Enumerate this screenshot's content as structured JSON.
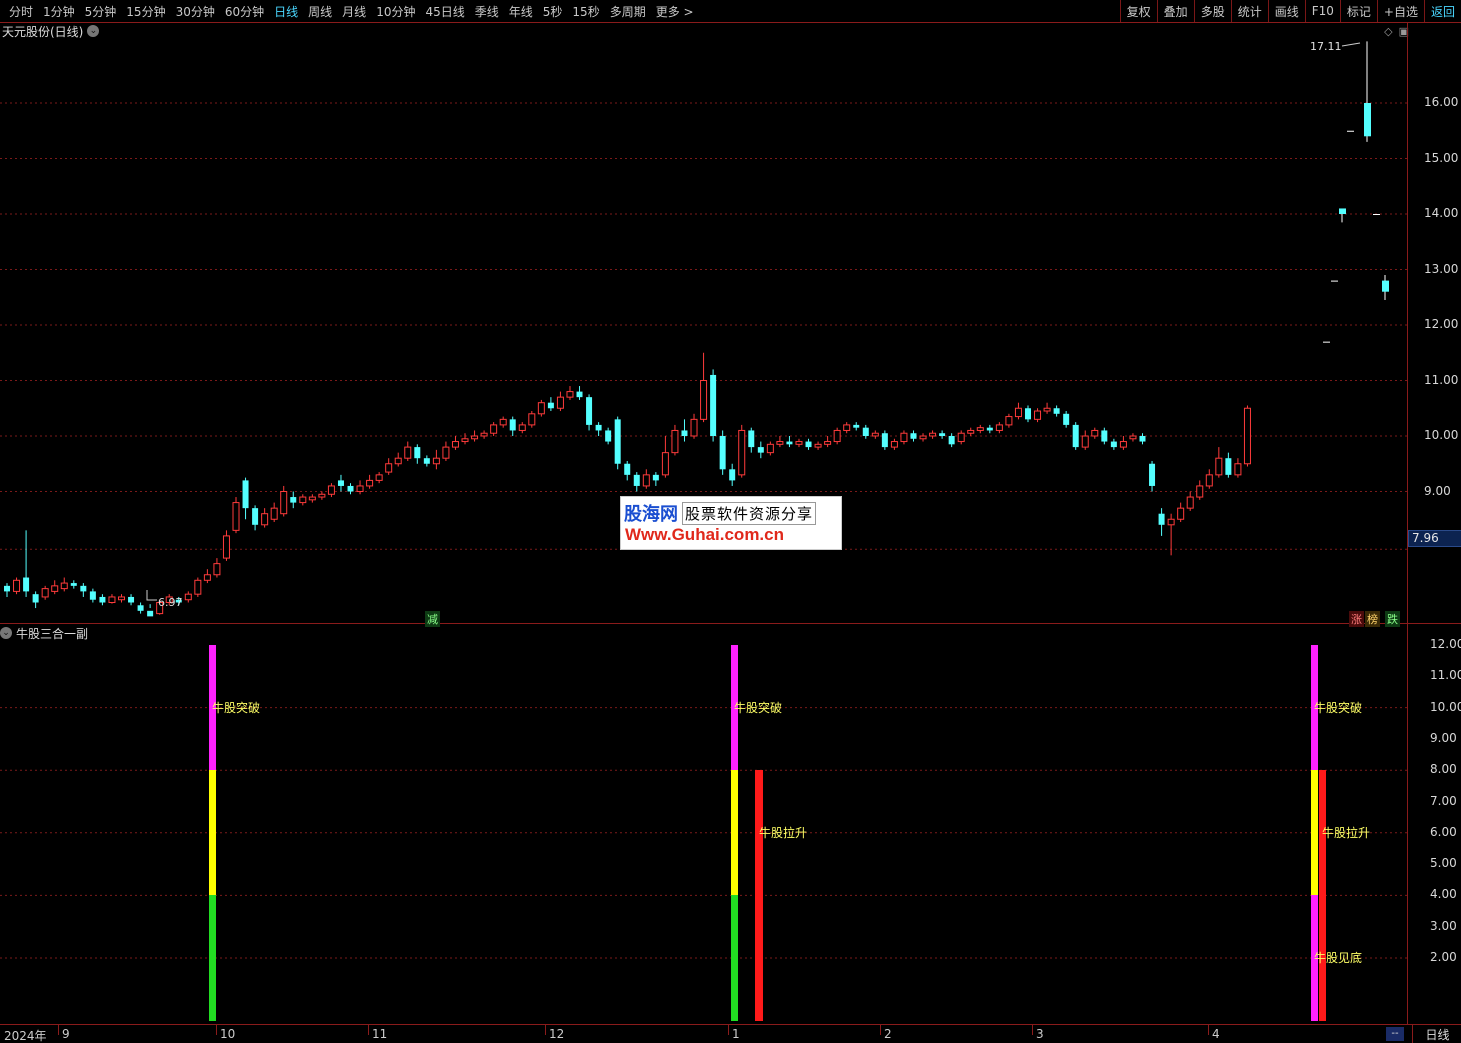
{
  "toolbar": {
    "periods": [
      "分时",
      "1分钟",
      "5分钟",
      "15分钟",
      "30分钟",
      "60分钟",
      "日线",
      "周线",
      "月线",
      "10分钟",
      "45日线",
      "季线",
      "年线",
      "5秒",
      "15秒",
      "多周期",
      "更多 >"
    ],
    "active_period": "日线",
    "tools": [
      "复权",
      "叠加",
      "多股",
      "统计",
      "画线",
      "F10",
      "标记",
      "+自选",
      "返回"
    ]
  },
  "main_panel": {
    "title": "天元股份(日线)",
    "high_label": "17.11",
    "low_label": "6.97",
    "current_price_tag": "7.96",
    "price_axis": [
      "16.00",
      "15.00",
      "14.00",
      "13.00",
      "12.00",
      "11.00",
      "10.00",
      "9.00"
    ],
    "badges": {
      "reduce": "减",
      "up": "涨",
      "rank": "榜",
      "down": "跌"
    }
  },
  "sub_panel": {
    "title": "牛股三合一副",
    "axis": [
      "12.00",
      "11.00",
      "10.00",
      "9.00",
      "8.00",
      "7.00",
      "6.00",
      "5.00",
      "4.00",
      "3.00",
      "2.00"
    ],
    "signals": {
      "breakout": "牛股突破",
      "lift": "牛股拉升",
      "bottom": "牛股见底"
    }
  },
  "time_axis": {
    "labels": [
      "2024年",
      "9",
      "10",
      "11",
      "12",
      "1",
      "2",
      "3",
      "4"
    ],
    "period_button": "日线",
    "dash_button": "--"
  },
  "watermark": {
    "brand": "股海网",
    "slogan": "股票软件资源分享",
    "url": "Www.Guhai.com.cn"
  },
  "chart_data": {
    "type": "candlestick",
    "title": "天元股份(日线)",
    "ylim": [
      7.5,
      17.5
    ],
    "highest": 17.11,
    "lowest": 6.97,
    "last_price": 7.96,
    "up_color": "#ff3b3b",
    "down_color": "#54ffff",
    "candles": [
      [
        7.3,
        7.2,
        7.1,
        7.35
      ],
      [
        7.2,
        7.4,
        7.15,
        7.45
      ],
      [
        7.45,
        7.2,
        7.1,
        8.3
      ],
      [
        7.15,
        7.0,
        6.9,
        7.2
      ],
      [
        7.1,
        7.25,
        7.05,
        7.3
      ],
      [
        7.2,
        7.3,
        7.15,
        7.4
      ],
      [
        7.25,
        7.35,
        7.2,
        7.45
      ],
      [
        7.35,
        7.3,
        7.25,
        7.4
      ],
      [
        7.3,
        7.2,
        7.1,
        7.35
      ],
      [
        7.2,
        7.05,
        7.0,
        7.25
      ],
      [
        7.1,
        7.0,
        6.95,
        7.15
      ],
      [
        7.0,
        7.1,
        6.98,
        7.15
      ],
      [
        7.05,
        7.1,
        7.0,
        7.15
      ],
      [
        7.1,
        7.0,
        6.95,
        7.15
      ],
      [
        6.95,
        6.85,
        6.8,
        7.0
      ],
      [
        6.85,
        6.75,
        6.97,
        6.9
      ],
      [
        6.8,
        7.0,
        6.78,
        7.05
      ],
      [
        7.0,
        7.1,
        6.95,
        7.15
      ],
      [
        7.05,
        7.0,
        6.95,
        7.1
      ],
      [
        7.05,
        7.15,
        7.0,
        7.2
      ],
      [
        7.15,
        7.4,
        7.1,
        7.45
      ],
      [
        7.4,
        7.5,
        7.35,
        7.6
      ],
      [
        7.5,
        7.7,
        7.45,
        7.8
      ],
      [
        7.8,
        8.2,
        7.75,
        8.3
      ],
      [
        8.3,
        8.8,
        8.25,
        8.9
      ],
      [
        9.2,
        8.7,
        8.5,
        9.25
      ],
      [
        8.7,
        8.4,
        8.3,
        8.75
      ],
      [
        8.4,
        8.6,
        8.35,
        8.7
      ],
      [
        8.5,
        8.7,
        8.45,
        8.8
      ],
      [
        8.6,
        9.0,
        8.55,
        9.1
      ],
      [
        8.9,
        8.8,
        8.7,
        9.0
      ],
      [
        8.8,
        8.9,
        8.75,
        8.95
      ],
      [
        8.85,
        8.9,
        8.8,
        8.95
      ],
      [
        8.9,
        8.95,
        8.85,
        9.0
      ],
      [
        8.95,
        9.1,
        8.9,
        9.15
      ],
      [
        9.2,
        9.1,
        9.0,
        9.3
      ],
      [
        9.1,
        9.0,
        8.95,
        9.15
      ],
      [
        9.0,
        9.1,
        8.95,
        9.2
      ],
      [
        9.1,
        9.2,
        9.05,
        9.3
      ],
      [
        9.2,
        9.3,
        9.15,
        9.35
      ],
      [
        9.35,
        9.5,
        9.3,
        9.6
      ],
      [
        9.5,
        9.6,
        9.45,
        9.7
      ],
      [
        9.6,
        9.8,
        9.55,
        9.9
      ],
      [
        9.8,
        9.6,
        9.5,
        9.85
      ],
      [
        9.6,
        9.5,
        9.45,
        9.65
      ],
      [
        9.5,
        9.6,
        9.4,
        9.75
      ],
      [
        9.6,
        9.8,
        9.55,
        9.9
      ],
      [
        9.8,
        9.9,
        9.75,
        10.0
      ],
      [
        9.9,
        9.95,
        9.85,
        10.05
      ],
      [
        9.95,
        10.0,
        9.9,
        10.1
      ],
      [
        10.0,
        10.05,
        9.95,
        10.1
      ],
      [
        10.05,
        10.2,
        10.0,
        10.25
      ],
      [
        10.2,
        10.3,
        10.15,
        10.35
      ],
      [
        10.3,
        10.1,
        10.0,
        10.35
      ],
      [
        10.1,
        10.2,
        10.05,
        10.25
      ],
      [
        10.2,
        10.4,
        10.15,
        10.45
      ],
      [
        10.4,
        10.6,
        10.35,
        10.65
      ],
      [
        10.6,
        10.5,
        10.45,
        10.7
      ],
      [
        10.5,
        10.7,
        10.45,
        10.8
      ],
      [
        10.7,
        10.8,
        10.65,
        10.9
      ],
      [
        10.8,
        10.7,
        10.65,
        10.9
      ],
      [
        10.7,
        10.2,
        10.1,
        10.75
      ],
      [
        10.2,
        10.1,
        10.0,
        10.25
      ],
      [
        10.1,
        9.9,
        9.85,
        10.15
      ],
      [
        10.3,
        9.5,
        9.4,
        10.35
      ],
      [
        9.5,
        9.3,
        9.2,
        9.55
      ],
      [
        9.3,
        9.1,
        9.0,
        9.35
      ],
      [
        9.1,
        9.3,
        9.05,
        9.4
      ],
      [
        9.3,
        9.2,
        9.1,
        9.35
      ],
      [
        9.3,
        9.7,
        9.25,
        10.0
      ],
      [
        9.7,
        10.1,
        9.65,
        10.2
      ],
      [
        10.1,
        10.0,
        9.9,
        10.3
      ],
      [
        10.0,
        10.3,
        9.95,
        10.4
      ],
      [
        10.3,
        11.0,
        10.25,
        11.5
      ],
      [
        11.1,
        10.0,
        9.9,
        11.2
      ],
      [
        10.0,
        9.4,
        9.3,
        10.1
      ],
      [
        9.4,
        9.2,
        9.1,
        9.5
      ],
      [
        9.3,
        10.1,
        9.25,
        10.2
      ],
      [
        10.1,
        9.8,
        9.7,
        10.15
      ],
      [
        9.8,
        9.7,
        9.6,
        9.9
      ],
      [
        9.7,
        9.85,
        9.65,
        9.9
      ],
      [
        9.85,
        9.9,
        9.8,
        10.0
      ],
      [
        9.9,
        9.85,
        9.8,
        10.0
      ],
      [
        9.85,
        9.9,
        9.8,
        9.95
      ],
      [
        9.9,
        9.8,
        9.75,
        9.95
      ],
      [
        9.8,
        9.85,
        9.75,
        9.9
      ],
      [
        9.85,
        9.9,
        9.8,
        10.0
      ],
      [
        9.9,
        10.1,
        9.85,
        10.15
      ],
      [
        10.1,
        10.2,
        10.05,
        10.25
      ],
      [
        10.2,
        10.15,
        10.1,
        10.25
      ],
      [
        10.15,
        10.0,
        9.95,
        10.2
      ],
      [
        10.0,
        10.05,
        9.95,
        10.1
      ],
      [
        10.05,
        9.8,
        9.75,
        10.1
      ],
      [
        9.8,
        9.9,
        9.75,
        9.95
      ],
      [
        9.9,
        10.05,
        9.85,
        10.1
      ],
      [
        10.05,
        9.95,
        9.9,
        10.1
      ],
      [
        9.95,
        10.0,
        9.9,
        10.05
      ],
      [
        10.0,
        10.05,
        9.95,
        10.1
      ],
      [
        10.05,
        10.0,
        9.95,
        10.1
      ],
      [
        10.0,
        9.85,
        9.8,
        10.05
      ],
      [
        9.9,
        10.05,
        9.85,
        10.1
      ],
      [
        10.05,
        10.1,
        10.0,
        10.15
      ],
      [
        10.1,
        10.15,
        10.05,
        10.2
      ],
      [
        10.15,
        10.1,
        10.05,
        10.2
      ],
      [
        10.1,
        10.2,
        10.05,
        10.25
      ],
      [
        10.2,
        10.35,
        10.15,
        10.4
      ],
      [
        10.35,
        10.5,
        10.3,
        10.6
      ],
      [
        10.5,
        10.3,
        10.25,
        10.55
      ],
      [
        10.3,
        10.45,
        10.25,
        10.5
      ],
      [
        10.45,
        10.5,
        10.4,
        10.6
      ],
      [
        10.5,
        10.4,
        10.35,
        10.55
      ],
      [
        10.4,
        10.2,
        10.15,
        10.45
      ],
      [
        10.2,
        9.8,
        9.75,
        10.25
      ],
      [
        9.8,
        10.0,
        9.75,
        10.1
      ],
      [
        10.0,
        10.1,
        9.95,
        10.15
      ],
      [
        10.1,
        9.9,
        9.85,
        10.15
      ],
      [
        9.9,
        9.8,
        9.75,
        9.95
      ],
      [
        9.8,
        9.9,
        9.75,
        10.0
      ],
      [
        9.95,
        10.0,
        9.9,
        10.05
      ],
      [
        10.0,
        9.9,
        9.85,
        10.05
      ],
      [
        9.5,
        9.1,
        9.0,
        9.55
      ],
      [
        8.6,
        8.4,
        8.2,
        8.7
      ],
      [
        8.4,
        8.5,
        7.85,
        8.6
      ],
      [
        8.5,
        8.7,
        8.45,
        8.8
      ],
      [
        8.7,
        8.9,
        8.65,
        9.0
      ],
      [
        8.9,
        9.1,
        8.85,
        9.2
      ],
      [
        9.1,
        9.3,
        9.05,
        9.4
      ],
      [
        9.3,
        9.6,
        9.25,
        9.8
      ],
      [
        9.6,
        9.3,
        9.25,
        9.7
      ],
      [
        9.3,
        9.5,
        9.25,
        9.6
      ],
      [
        9.5,
        10.5,
        9.45,
        10.55
      ],
      [
        11.7,
        11.7,
        11.7,
        11.7
      ],
      [
        12.8,
        12.8,
        12.8,
        12.8
      ],
      [
        14.1,
        14.0,
        13.85,
        14.1
      ],
      [
        15.5,
        15.5,
        15.5,
        15.5
      ],
      [
        16.0,
        15.4,
        15.3,
        17.11
      ],
      [
        14.0,
        14.0,
        14.0,
        14.0
      ],
      [
        12.8,
        12.6,
        12.45,
        12.9
      ]
    ]
  }
}
